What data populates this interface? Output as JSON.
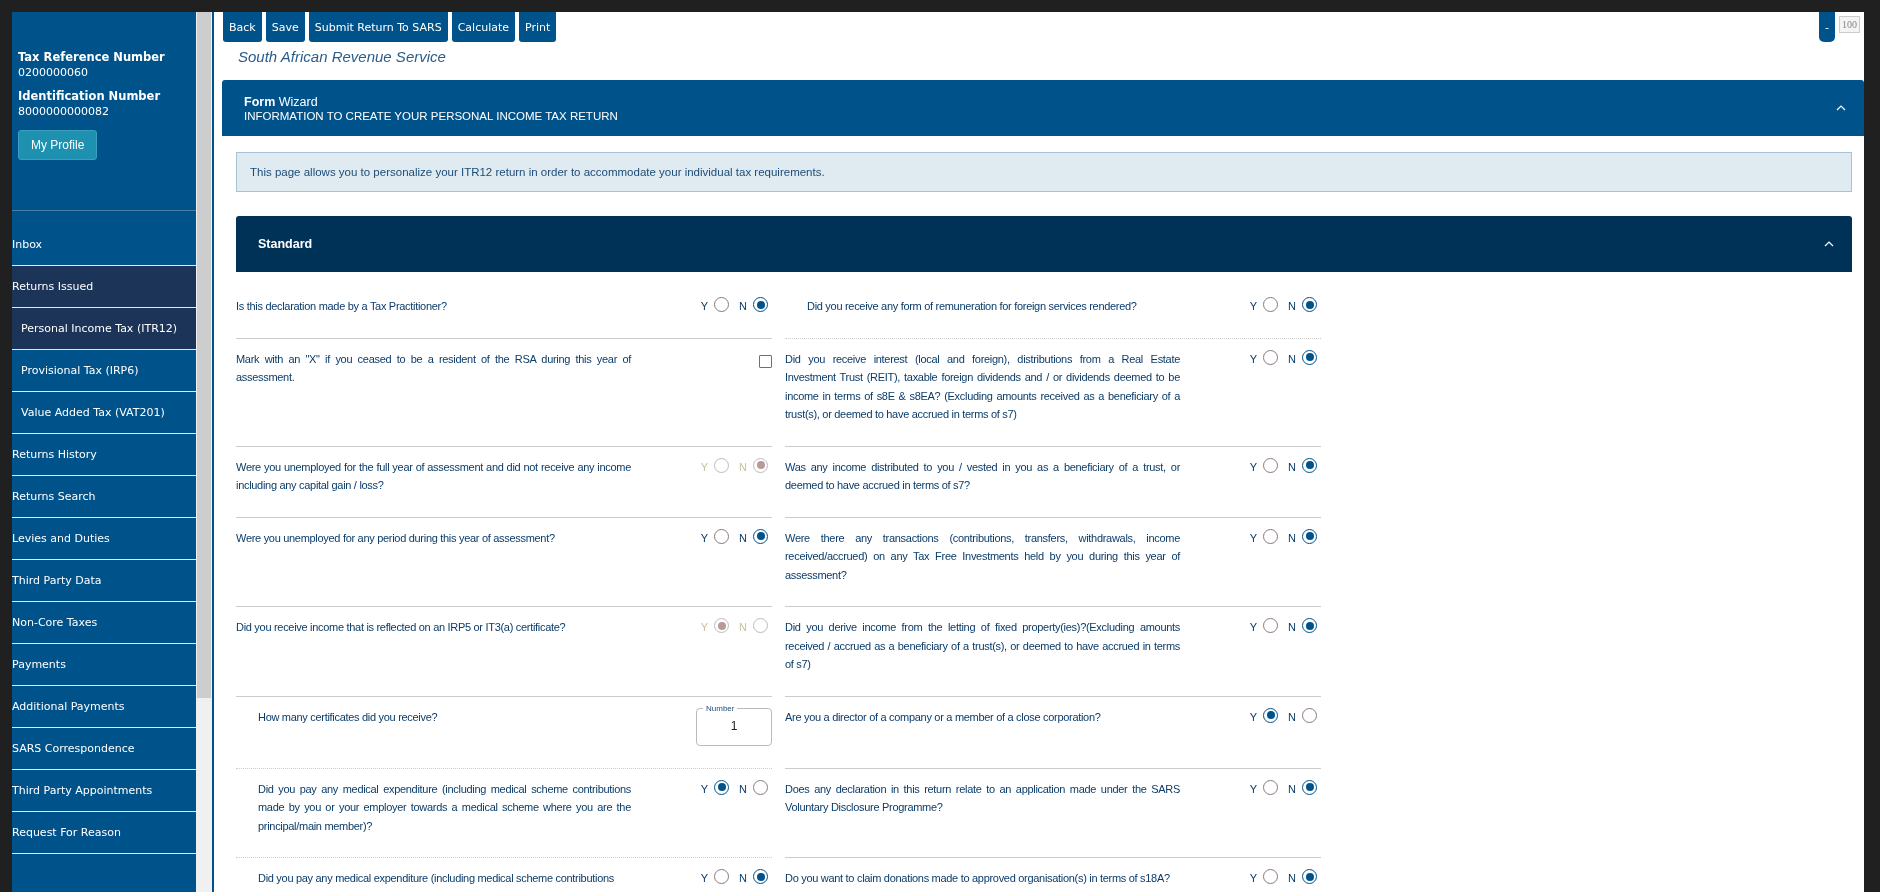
{
  "sidebar": {
    "profile": [
      {
        "label": "Tax Reference Number",
        "value": "0200000060"
      },
      {
        "label": "Identification Number",
        "value": "8000000000082"
      }
    ],
    "profile_button": "My Profile",
    "items": [
      {
        "label": "Inbox",
        "selected": false
      },
      {
        "label": "Returns Issued",
        "selected": true,
        "children": [
          {
            "label": "Personal Income Tax (ITR12)",
            "selected": true
          },
          {
            "label": "Provisional Tax (IRP6)",
            "selected": false
          },
          {
            "label": "Value Added Tax (VAT201)",
            "selected": false
          }
        ]
      },
      {
        "label": "Returns History",
        "selected": false
      },
      {
        "label": "Returns Search",
        "selected": false
      },
      {
        "label": "Levies and Duties",
        "selected": false
      },
      {
        "label": "Third Party Data",
        "selected": false
      },
      {
        "label": "Non-Core Taxes",
        "selected": false
      },
      {
        "label": "Payments",
        "selected": false
      },
      {
        "label": "Additional Payments",
        "selected": false
      },
      {
        "label": "SARS Correspondence",
        "selected": false
      },
      {
        "label": "Third Party Appointments",
        "selected": false
      },
      {
        "label": "Request For Reason",
        "selected": false
      }
    ]
  },
  "toolbar": {
    "buttons": [
      "Back",
      "Save",
      "Submit Return To SARS",
      "Calculate",
      "Print"
    ],
    "zoom_button": "-",
    "zoom_value": "100"
  },
  "agency_name": "South African Revenue Service",
  "form_wizard": {
    "title_bold": "Form",
    "title": "Wizard",
    "subtitle": "INFORMATION TO CREATE YOUR PERSONAL INCOME TAX RETURN",
    "expanded": true
  },
  "info": "This page allows you to personalize your ITR12 return in order to accommodate your individual tax requirements.",
  "section": {
    "title": "Standard",
    "expanded": true
  },
  "rows": [
    {
      "cells": [
        {
          "kind": "yesno",
          "indented": false,
          "disabled": false,
          "text": "Is this declaration made by a Tax Practitioner?",
          "options": [
            {
              "label": "Y",
              "selected": false
            },
            {
              "label": "N",
              "selected": true
            }
          ]
        },
        {
          "kind": "yesno",
          "indented": true,
          "disabled": false,
          "text": "Did you receive any form of remuneration for foreign services rendered?",
          "options": [
            {
              "label": "Y",
              "selected": false
            },
            {
              "label": "N",
              "selected": true
            }
          ]
        }
      ]
    },
    {
      "cells": [
        {
          "kind": "checkbox",
          "indented": false,
          "text": "Mark with an \"X\" if you ceased to be a resident of the RSA during this year of assessment.",
          "checked": false
        },
        {
          "kind": "yesno",
          "indented": false,
          "disabled": false,
          "text": "Did you receive interest (local and foreign), distributions from a Real Estate Investment Trust (REIT), taxable foreign dividends and / or dividends deemed to be income in terms of s8E & s8EA? (Excluding amounts received as a beneficiary of a trust(s), or deemed to have accrued in terms of s7)",
          "options": [
            {
              "label": "Y",
              "selected": false
            },
            {
              "label": "N",
              "selected": true
            }
          ]
        }
      ]
    },
    {
      "cells": [
        {
          "kind": "yesno",
          "indented": false,
          "disabled": true,
          "text": "Were you unemployed for the full year of assessment and did not receive any income including any capital gain / loss?",
          "options": [
            {
              "label": "Y",
              "selected": false
            },
            {
              "label": "N",
              "selected": true
            }
          ]
        },
        {
          "kind": "yesno",
          "indented": false,
          "disabled": false,
          "text": "Was any income distributed to you / vested in you as a beneficiary of a trust, or deemed to have accrued in terms of s7?",
          "options": [
            {
              "label": "Y",
              "selected": false
            },
            {
              "label": "N",
              "selected": true
            }
          ]
        }
      ]
    },
    {
      "cells": [
        {
          "kind": "yesno",
          "indented": false,
          "disabled": false,
          "text": "Were you unemployed for any period during this year of assessment?",
          "options": [
            {
              "label": "Y",
              "selected": false
            },
            {
              "label": "N",
              "selected": true
            }
          ]
        },
        {
          "kind": "yesno",
          "indented": false,
          "disabled": false,
          "text": "Were there any transactions (contributions, transfers, withdrawals, income received/accrued) on any Tax Free Investments held by you during this year of assessment?",
          "options": [
            {
              "label": "Y",
              "selected": false
            },
            {
              "label": "N",
              "selected": true
            }
          ]
        }
      ]
    },
    {
      "cells": [
        {
          "kind": "yesno",
          "indented": false,
          "disabled": true,
          "text": "Did you receive income that is reflected on an IRP5 or IT3(a) certificate?",
          "options": [
            {
              "label": "Y",
              "selected": true
            },
            {
              "label": "N",
              "selected": false
            }
          ]
        },
        {
          "kind": "yesno",
          "indented": false,
          "disabled": false,
          "text": "Did you derive income from the letting of fixed property(ies)?(Excluding amounts received / accrued as a beneficiary of a trust(s), or deemed to have accrued in terms of s7)",
          "options": [
            {
              "label": "Y",
              "selected": false
            },
            {
              "label": "N",
              "selected": true
            }
          ]
        }
      ]
    },
    {
      "cells": [
        {
          "kind": "number",
          "indented": true,
          "text": "How many certificates did you receive?",
          "field_label": "Number",
          "value": "1"
        },
        {
          "kind": "yesno",
          "indented": false,
          "disabled": false,
          "text": "Are you a director of a company or a member of a close corporation?",
          "options": [
            {
              "label": "Y",
              "selected": true
            },
            {
              "label": "N",
              "selected": false
            }
          ]
        }
      ]
    },
    {
      "cells": [
        {
          "kind": "yesno",
          "indented": true,
          "disabled": false,
          "text": "Did you pay any medical expenditure (including medical scheme contributions made by you or your employer towards a medical scheme where you are the principal/main member)?",
          "options": [
            {
              "label": "Y",
              "selected": true
            },
            {
              "label": "N",
              "selected": false
            }
          ]
        },
        {
          "kind": "yesno",
          "indented": false,
          "disabled": false,
          "text": "Does any declaration in this return relate to an application made under the SARS Voluntary Disclosure Programme?",
          "options": [
            {
              "label": "Y",
              "selected": false
            },
            {
              "label": "N",
              "selected": true
            }
          ]
        }
      ]
    },
    {
      "cells": [
        {
          "kind": "yesno",
          "indented": true,
          "disabled": false,
          "text": "Did you pay any medical expenditure (including medical scheme contributions",
          "options": [
            {
              "label": "Y",
              "selected": false
            },
            {
              "label": "N",
              "selected": true
            }
          ]
        },
        {
          "kind": "yesno",
          "indented": false,
          "disabled": false,
          "text": "Do you want to claim donations made to approved organisation(s) in terms of s18A?",
          "options": [
            {
              "label": "Y",
              "selected": false
            },
            {
              "label": "N",
              "selected": true
            }
          ]
        }
      ]
    }
  ]
}
